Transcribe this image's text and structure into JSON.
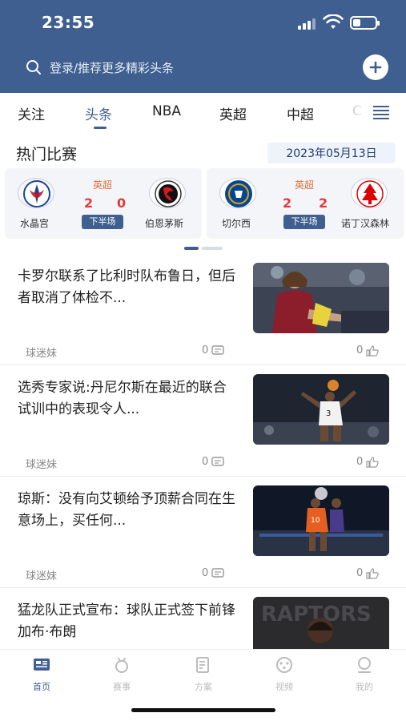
{
  "status_bar": {
    "time": "23:55",
    "battery_level": 0.35
  },
  "search": {
    "placeholder": "登录/推荐更多精彩头条",
    "search_icon": "search-icon",
    "add_icon": "plus-circle-icon"
  },
  "tabs": [
    {
      "label": "关注",
      "active": false
    },
    {
      "label": "头条",
      "active": true
    },
    {
      "label": "NBA",
      "active": false
    },
    {
      "label": "英超",
      "active": false
    },
    {
      "label": "中超",
      "active": false
    },
    {
      "label": "C",
      "active": false
    }
  ],
  "hot_matches": {
    "title": "热门比赛",
    "date": "2023年05月13日",
    "items": [
      {
        "league": "英超",
        "home_team": "水晶宫",
        "away_team": "伯恩茅斯",
        "home_score": "2",
        "away_score": "0",
        "period": "下半场"
      },
      {
        "league": "英超",
        "home_team": "切尔西",
        "away_team": "诺丁汉森林",
        "home_score": "2",
        "away_score": "2",
        "period": "下半场"
      }
    ],
    "page_indicator": {
      "count": 2,
      "active": 0
    }
  },
  "articles": [
    {
      "title": "卡罗尔联系了比利时队布鲁日，但后者取消了体检不...",
      "author": "球迷妹",
      "comments": "0",
      "likes": "0"
    },
    {
      "title": "选秀专家说:丹尼尔斯在最近的联合试训中的表现令人...",
      "author": "球迷妹",
      "comments": "0",
      "likes": "0"
    },
    {
      "title": "琼斯：没有向艾顿给予顶薪合同在生意场上，买任何...",
      "author": "球迷妹",
      "comments": "0",
      "likes": "0"
    },
    {
      "title": "猛龙队正式宣布：球队正式签下前锋加布·布朗",
      "author": "",
      "comments": "",
      "likes": ""
    }
  ],
  "bottom_nav": [
    {
      "label": "首页",
      "icon": "home-icon",
      "active": true
    },
    {
      "label": "赛事",
      "icon": "trophy-icon",
      "active": false
    },
    {
      "label": "方案",
      "icon": "document-icon",
      "active": false
    },
    {
      "label": "视频",
      "icon": "video-icon",
      "active": false
    },
    {
      "label": "我的",
      "icon": "profile-icon",
      "active": false
    }
  ],
  "colors": {
    "brand": "#3e5f8f",
    "score_red": "#e03a3a",
    "league_orange": "#e06b3a"
  }
}
